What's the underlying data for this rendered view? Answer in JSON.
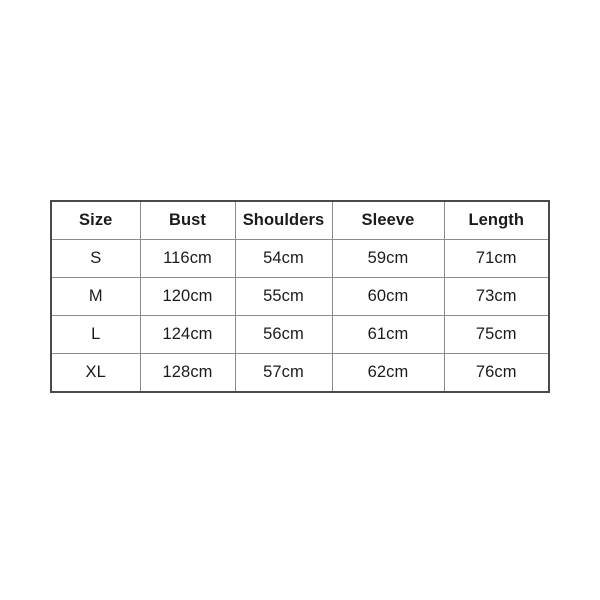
{
  "page": {
    "background_color": "#ffffff"
  },
  "chart_data": {
    "type": "table",
    "title": "",
    "columns": [
      "Size",
      "Bust",
      "Shoulders",
      "Sleeve",
      "Length"
    ],
    "rows": [
      [
        "S",
        "116cm",
        "54cm",
        "59cm",
        "71cm"
      ],
      [
        "M",
        "120cm",
        "55cm",
        "60cm",
        "73cm"
      ],
      [
        "L",
        "124cm",
        "56cm",
        "61cm",
        "75cm"
      ],
      [
        "XL",
        "128cm",
        "57cm",
        "62cm",
        "76cm"
      ]
    ],
    "unit": "cm",
    "colors": {
      "text": "#1b1b1b",
      "outer_border": "#4a4a4a",
      "inner_border": "#8d8d8d",
      "cell_background": "#ffffff"
    }
  },
  "table": {
    "headers": {
      "size": "Size",
      "bust": "Bust",
      "shoulders": "Shoulders",
      "sleeve": "Sleeve",
      "length": "Length"
    },
    "rows": [
      {
        "size": "S",
        "bust": "116cm",
        "shoulders": "54cm",
        "sleeve": "59cm",
        "length": "71cm"
      },
      {
        "size": "M",
        "bust": "120cm",
        "shoulders": "55cm",
        "sleeve": "60cm",
        "length": "73cm"
      },
      {
        "size": "L",
        "bust": "124cm",
        "shoulders": "56cm",
        "sleeve": "61cm",
        "length": "75cm"
      },
      {
        "size": "XL",
        "bust": "128cm",
        "shoulders": "57cm",
        "sleeve": "62cm",
        "length": "76cm"
      }
    ]
  }
}
